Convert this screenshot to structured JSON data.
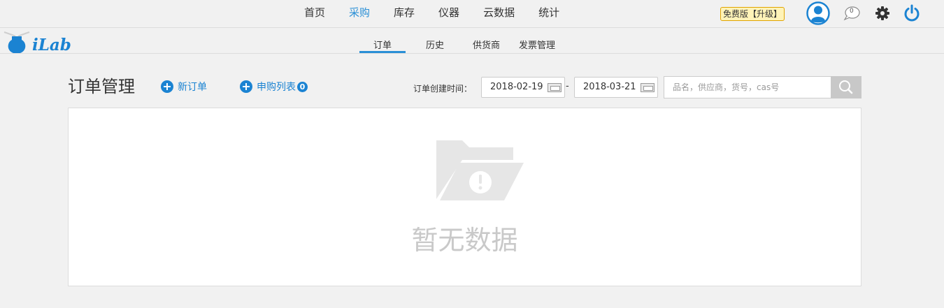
{
  "nav": {
    "items": [
      {
        "label": "首页",
        "active": false
      },
      {
        "label": "采购",
        "active": true
      },
      {
        "label": "库存",
        "active": false
      },
      {
        "label": "仪器",
        "active": false
      },
      {
        "label": "云数据",
        "active": false
      },
      {
        "label": "统计",
        "active": false
      }
    ]
  },
  "header": {
    "logo_text": "iLab",
    "upgrade_label": "免费版【升级】",
    "message_count": "0",
    "icons": [
      "user-avatar-icon",
      "message-bubble-icon",
      "gear-icon",
      "power-icon"
    ]
  },
  "subnav": {
    "items": [
      {
        "label": "订单",
        "active": true
      },
      {
        "label": "历史",
        "active": false
      },
      {
        "label": "供货商",
        "active": false
      },
      {
        "label": "发票管理",
        "active": false
      }
    ]
  },
  "toolbar": {
    "title": "订单管理",
    "new_order_label": "新订单",
    "purchase_list_label": "申购列表",
    "purchase_list_count": "0",
    "date_label": "订单创建时间：",
    "date_from": "2018-02-19",
    "date_separator": "-",
    "date_to": "2018-03-21",
    "search_placeholder": "品名，供应商，货号，cas号"
  },
  "panel": {
    "empty_text": "暂无数据"
  },
  "colors": {
    "accent": "#2a8fd6",
    "brand": "#1b83d2",
    "background": "#f1f1f1"
  }
}
